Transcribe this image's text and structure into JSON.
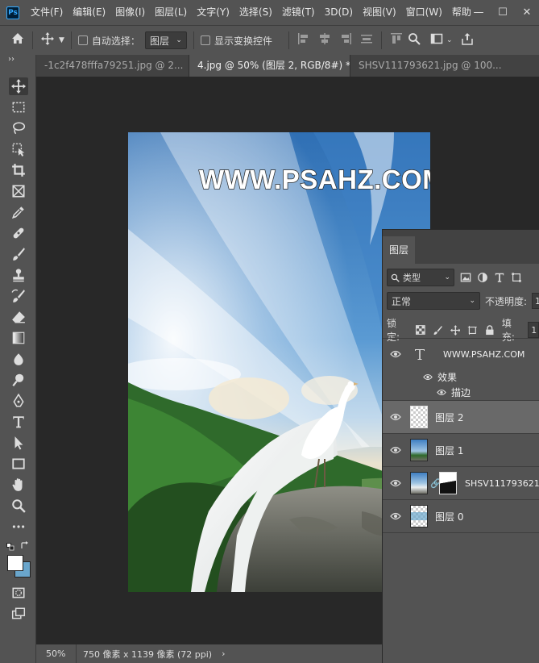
{
  "app": {
    "logo_text": "Ps"
  },
  "menu": [
    "文件(F)",
    "编辑(E)",
    "图像(I)",
    "图层(L)",
    "文字(Y)",
    "选择(S)",
    "滤镜(T)",
    "3D(D)",
    "视图(V)",
    "窗口(W)",
    "帮助"
  ],
  "options_bar": {
    "auto_select_label": "自动选择：",
    "auto_select_value": "图层",
    "show_transform_label": "显示变换控件"
  },
  "tabs": [
    {
      "label": "-1c2f478fffa79251.jpg @ 2...",
      "active": false
    },
    {
      "label": "4.jpg @ 50% (图层 2, RGB/8#) *",
      "active": true
    },
    {
      "label": "SHSV111793621.jpg @ 100...",
      "active": false
    }
  ],
  "document": {
    "watermark": "WWW.PSAHZ.COM"
  },
  "status": {
    "zoom": "50%",
    "doc_info": "750 像素 x 1139 像素 (72 ppi)"
  },
  "layers_panel": {
    "tab_label": "图层",
    "kind_filter": "类型",
    "blend_mode": "正常",
    "opacity_label": "不透明度:",
    "opacity_value": "1",
    "lock_label": "锁定:",
    "fill_label": "填充:",
    "fill_value": "1",
    "layers": [
      {
        "name": "WWW.PSAHZ.COM",
        "type": "text",
        "effects_label": "效果",
        "effect": "描边"
      },
      {
        "name": "图层 2",
        "type": "transparent",
        "selected": true
      },
      {
        "name": "图层 1",
        "type": "image"
      },
      {
        "name": "SHSV111793621",
        "type": "masked"
      },
      {
        "name": "图层 0",
        "type": "image-transparent"
      }
    ]
  },
  "colors": {
    "foreground": "#ffffff",
    "background": "#6aa6cc",
    "accent": "#31a8ff"
  }
}
